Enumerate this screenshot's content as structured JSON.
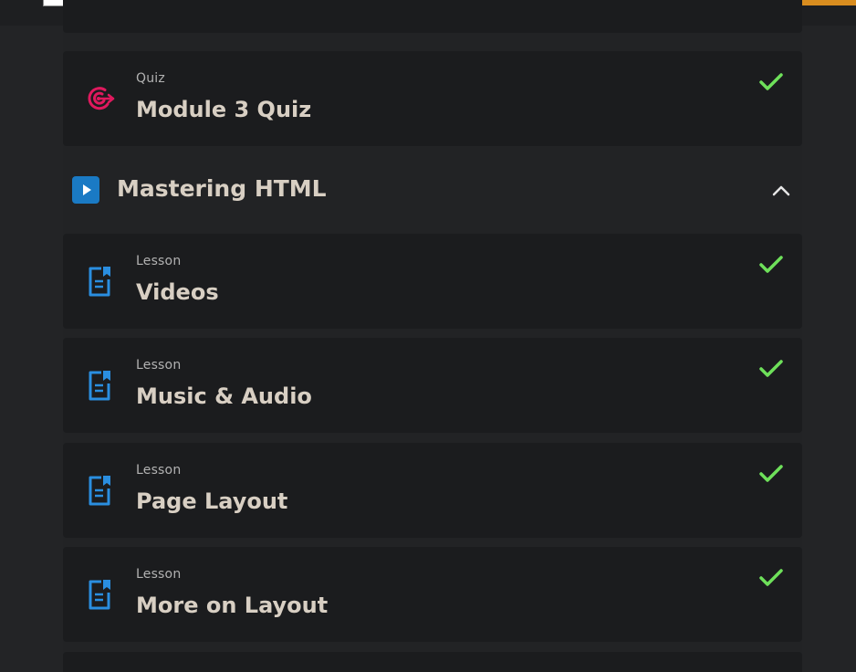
{
  "section": {
    "title": "Mastering HTML"
  },
  "items": [
    {
      "type": "Quiz",
      "title": "Module 3 Quiz",
      "status_icon": "check-icon",
      "icon": "target-icon"
    },
    {
      "type": "Lesson",
      "title": "Videos",
      "status_icon": "check-icon",
      "icon": "lesson-document-icon"
    },
    {
      "type": "Lesson",
      "title": "Music & Audio",
      "status_icon": "check-icon",
      "icon": "lesson-document-icon"
    },
    {
      "type": "Lesson",
      "title": "Page Layout",
      "status_icon": "check-icon",
      "icon": "lesson-document-icon"
    },
    {
      "type": "Lesson",
      "title": "More on Layout",
      "status_icon": "check-icon",
      "icon": "lesson-document-icon"
    }
  ],
  "colors": {
    "background": "#232426",
    "card": "#1b1c1e",
    "title_text": "#d8cfc3",
    "label_text": "#b2b2b2",
    "check": "#6ee05a",
    "quiz_icon": "#e0195e",
    "lesson_icon": "#2a8ee0",
    "play_badge": "#1a7ac4",
    "top_button": "#d98d1f"
  }
}
